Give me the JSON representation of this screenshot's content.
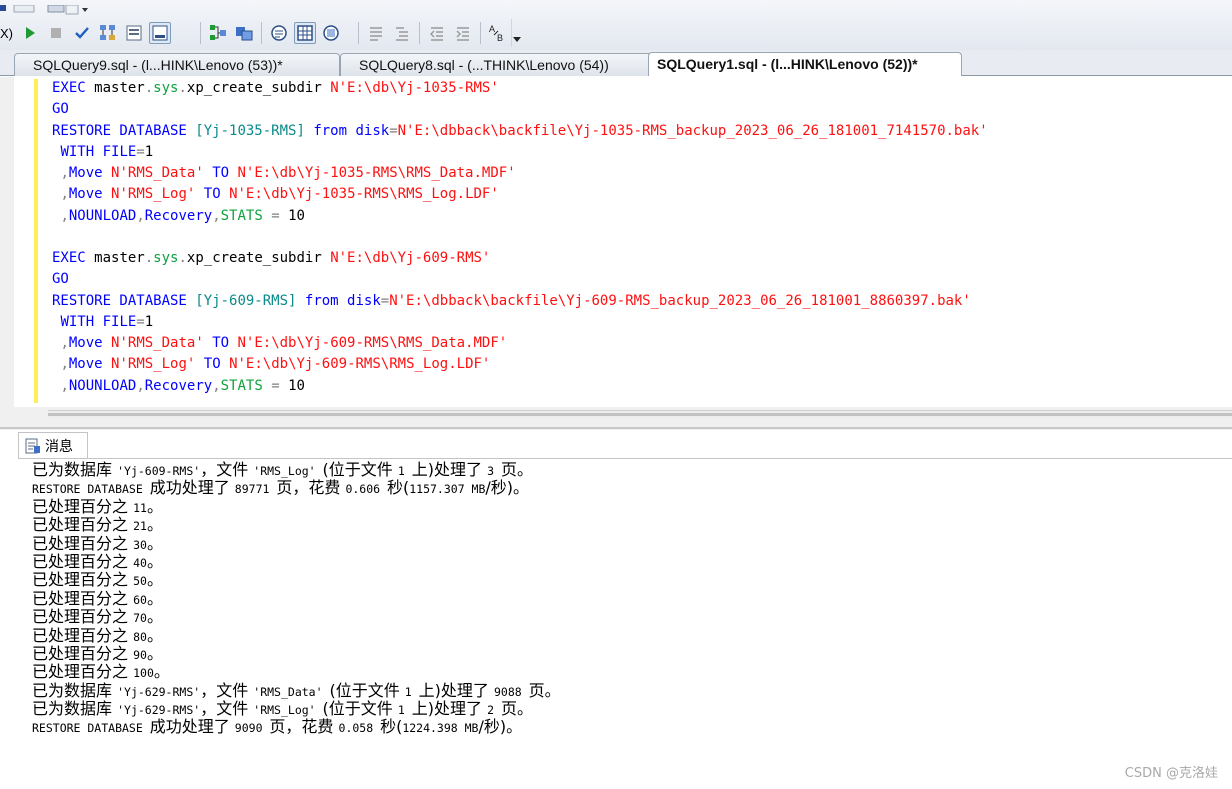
{
  "toolbar": {
    "partial_label": "X)",
    "buttons": [
      "execute-icon",
      "stop-icon",
      "parse-icon",
      "estimated-plan-icon",
      "query-options-icon",
      "results-to-grid-icon",
      "include-plan-icon",
      "client-stats-icon",
      "results-to-text-icon",
      "results-to-file-icon",
      "comment-icon",
      "uncomment-icon",
      "decrease-indent-icon",
      "increase-indent-icon",
      "specify-values-icon"
    ]
  },
  "tabs": [
    {
      "label": "SQLQuery9.sql - (l...HINK\\Lenovo (53))*",
      "active": false
    },
    {
      "label": "SQLQuery8.sql - (...THINK\\Lenovo (54))",
      "active": false
    },
    {
      "label": "SQLQuery1.sql - (l...HINK\\Lenovo (52))*",
      "active": true
    }
  ],
  "editor": {
    "lines": [
      [
        [
          "kw",
          "EXEC "
        ],
        [
          "pl",
          "master"
        ],
        [
          "pun",
          "."
        ],
        [
          "sys",
          "sys"
        ],
        [
          "pun",
          "."
        ],
        [
          "pl",
          "xp_create_subdir "
        ],
        [
          "str",
          "N'E:\\db\\Yj-1035-RMS'"
        ]
      ],
      [
        [
          "kw",
          "GO"
        ]
      ],
      [
        [
          "kw",
          "RESTORE DATABASE "
        ],
        [
          "obj",
          "[Yj-1035-RMS]"
        ],
        [
          "pl",
          " "
        ],
        [
          "kw",
          "from "
        ],
        [
          "kw",
          "disk"
        ],
        [
          "pun",
          "="
        ],
        [
          "str",
          "N'E:\\dbback\\backfile\\Yj-1035-RMS_backup_2023_06_26_181001_7141570.bak'"
        ]
      ],
      [
        [
          "pl",
          " "
        ],
        [
          "kw",
          "WITH FILE"
        ],
        [
          "pun",
          "="
        ],
        [
          "pl",
          "1"
        ]
      ],
      [
        [
          "pl",
          " "
        ],
        [
          "pun",
          ","
        ],
        [
          "kw",
          "Move "
        ],
        [
          "str",
          "N'RMS_Data'"
        ],
        [
          "pl",
          " "
        ],
        [
          "kw",
          "TO "
        ],
        [
          "str",
          "N'E:\\db\\Yj-1035-RMS\\RMS_Data.MDF'"
        ]
      ],
      [
        [
          "pl",
          " "
        ],
        [
          "pun",
          ","
        ],
        [
          "kw",
          "Move "
        ],
        [
          "str",
          "N'RMS_Log'"
        ],
        [
          "pl",
          " "
        ],
        [
          "kw",
          "TO "
        ],
        [
          "str",
          "N'E:\\db\\Yj-1035-RMS\\RMS_Log.LDF'"
        ]
      ],
      [
        [
          "pl",
          " "
        ],
        [
          "pun",
          ","
        ],
        [
          "kw",
          "NOUNLOAD"
        ],
        [
          "pun",
          ","
        ],
        [
          "kw",
          "Recovery"
        ],
        [
          "pun",
          ","
        ],
        [
          "sys",
          "STATS"
        ],
        [
          "pl",
          " "
        ],
        [
          "pun",
          "="
        ],
        [
          "pl",
          " 10"
        ]
      ],
      [
        [
          "pl",
          " "
        ]
      ],
      [
        [
          "kw",
          "EXEC "
        ],
        [
          "pl",
          "master"
        ],
        [
          "pun",
          "."
        ],
        [
          "sys",
          "sys"
        ],
        [
          "pun",
          "."
        ],
        [
          "pl",
          "xp_create_subdir "
        ],
        [
          "str",
          "N'E:\\db\\Yj-609-RMS'"
        ]
      ],
      [
        [
          "kw",
          "GO"
        ]
      ],
      [
        [
          "kw",
          "RESTORE DATABASE "
        ],
        [
          "obj",
          "[Yj-609-RMS]"
        ],
        [
          "pl",
          " "
        ],
        [
          "kw",
          "from "
        ],
        [
          "kw",
          "disk"
        ],
        [
          "pun",
          "="
        ],
        [
          "str",
          "N'E:\\dbback\\backfile\\Yj-609-RMS_backup_2023_06_26_181001_8860397.bak'"
        ]
      ],
      [
        [
          "pl",
          " "
        ],
        [
          "kw",
          "WITH FILE"
        ],
        [
          "pun",
          "="
        ],
        [
          "pl",
          "1"
        ]
      ],
      [
        [
          "pl",
          " "
        ],
        [
          "pun",
          ","
        ],
        [
          "kw",
          "Move "
        ],
        [
          "str",
          "N'RMS_Data'"
        ],
        [
          "pl",
          " "
        ],
        [
          "kw",
          "TO "
        ],
        [
          "str",
          "N'E:\\db\\Yj-609-RMS\\RMS_Data.MDF'"
        ]
      ],
      [
        [
          "pl",
          " "
        ],
        [
          "pun",
          ","
        ],
        [
          "kw",
          "Move "
        ],
        [
          "str",
          "N'RMS_Log'"
        ],
        [
          "pl",
          " "
        ],
        [
          "kw",
          "TO "
        ],
        [
          "str",
          "N'E:\\db\\Yj-609-RMS\\RMS_Log.LDF'"
        ]
      ],
      [
        [
          "pl",
          " "
        ],
        [
          "pun",
          ","
        ],
        [
          "kw",
          "NOUNLOAD"
        ],
        [
          "pun",
          ","
        ],
        [
          "kw",
          "Recovery"
        ],
        [
          "pun",
          ","
        ],
        [
          "sys",
          "STATS"
        ],
        [
          "pl",
          " "
        ],
        [
          "pun",
          "="
        ],
        [
          "pl",
          " 10"
        ]
      ]
    ]
  },
  "messages": {
    "tab_label": "消息",
    "lines": [
      [
        [
          "cn",
          "已为数据库 "
        ],
        [
          "mono",
          "'Yj-609-RMS'"
        ],
        [
          "cn",
          "，文件 "
        ],
        [
          "mono",
          "'RMS_Log' "
        ],
        [
          "cn",
          "(位于文件 "
        ],
        [
          "mono",
          "1 "
        ],
        [
          "cn",
          "上)处理了 "
        ],
        [
          "mono",
          "3 "
        ],
        [
          "cn",
          "页。"
        ]
      ],
      [
        [
          "mono",
          "RESTORE DATABASE "
        ],
        [
          "cn",
          "成功处理了 "
        ],
        [
          "mono",
          "89771 "
        ],
        [
          "cn",
          "页，花费 "
        ],
        [
          "mono",
          "0.606 "
        ],
        [
          "cn",
          "秒("
        ],
        [
          "mono",
          "1157.307 MB"
        ],
        [
          "cn",
          "/秒)。"
        ]
      ],
      [
        [
          "cn",
          "已处理百分之 "
        ],
        [
          "mono",
          "11"
        ],
        [
          "cn",
          "。"
        ]
      ],
      [
        [
          "cn",
          "已处理百分之 "
        ],
        [
          "mono",
          "21"
        ],
        [
          "cn",
          "。"
        ]
      ],
      [
        [
          "cn",
          "已处理百分之 "
        ],
        [
          "mono",
          "30"
        ],
        [
          "cn",
          "。"
        ]
      ],
      [
        [
          "cn",
          "已处理百分之 "
        ],
        [
          "mono",
          "40"
        ],
        [
          "cn",
          "。"
        ]
      ],
      [
        [
          "cn",
          "已处理百分之 "
        ],
        [
          "mono",
          "50"
        ],
        [
          "cn",
          "。"
        ]
      ],
      [
        [
          "cn",
          "已处理百分之 "
        ],
        [
          "mono",
          "60"
        ],
        [
          "cn",
          "。"
        ]
      ],
      [
        [
          "cn",
          "已处理百分之 "
        ],
        [
          "mono",
          "70"
        ],
        [
          "cn",
          "。"
        ]
      ],
      [
        [
          "cn",
          "已处理百分之 "
        ],
        [
          "mono",
          "80"
        ],
        [
          "cn",
          "。"
        ]
      ],
      [
        [
          "cn",
          "已处理百分之 "
        ],
        [
          "mono",
          "90"
        ],
        [
          "cn",
          "。"
        ]
      ],
      [
        [
          "cn",
          "已处理百分之 "
        ],
        [
          "mono",
          "100"
        ],
        [
          "cn",
          "。"
        ]
      ],
      [
        [
          "cn",
          "已为数据库 "
        ],
        [
          "mono",
          "'Yj-629-RMS'"
        ],
        [
          "cn",
          "，文件 "
        ],
        [
          "mono",
          "'RMS_Data' "
        ],
        [
          "cn",
          "(位于文件 "
        ],
        [
          "mono",
          "1 "
        ],
        [
          "cn",
          "上)处理了 "
        ],
        [
          "mono",
          "9088 "
        ],
        [
          "cn",
          "页。"
        ]
      ],
      [
        [
          "cn",
          "已为数据库 "
        ],
        [
          "mono",
          "'Yj-629-RMS'"
        ],
        [
          "cn",
          "，文件 "
        ],
        [
          "mono",
          "'RMS_Log' "
        ],
        [
          "cn",
          "(位于文件 "
        ],
        [
          "mono",
          "1 "
        ],
        [
          "cn",
          "上)处理了 "
        ],
        [
          "mono",
          "2 "
        ],
        [
          "cn",
          "页。"
        ]
      ],
      [
        [
          "mono",
          "RESTORE DATABASE "
        ],
        [
          "cn",
          "成功处理了 "
        ],
        [
          "mono",
          "9090 "
        ],
        [
          "cn",
          "页，花费 "
        ],
        [
          "mono",
          "0.058 "
        ],
        [
          "cn",
          "秒("
        ],
        [
          "mono",
          "1224.398 MB"
        ],
        [
          "cn",
          "/秒)。"
        ]
      ]
    ]
  },
  "watermark": "CSDN @克洛娃",
  "colors": {
    "keyword": "#0000ff",
    "system": "#0ea33d",
    "string": "#ff1010",
    "punctuation": "#808080",
    "object": "#0b8a8a",
    "margin": "#ffee55"
  }
}
